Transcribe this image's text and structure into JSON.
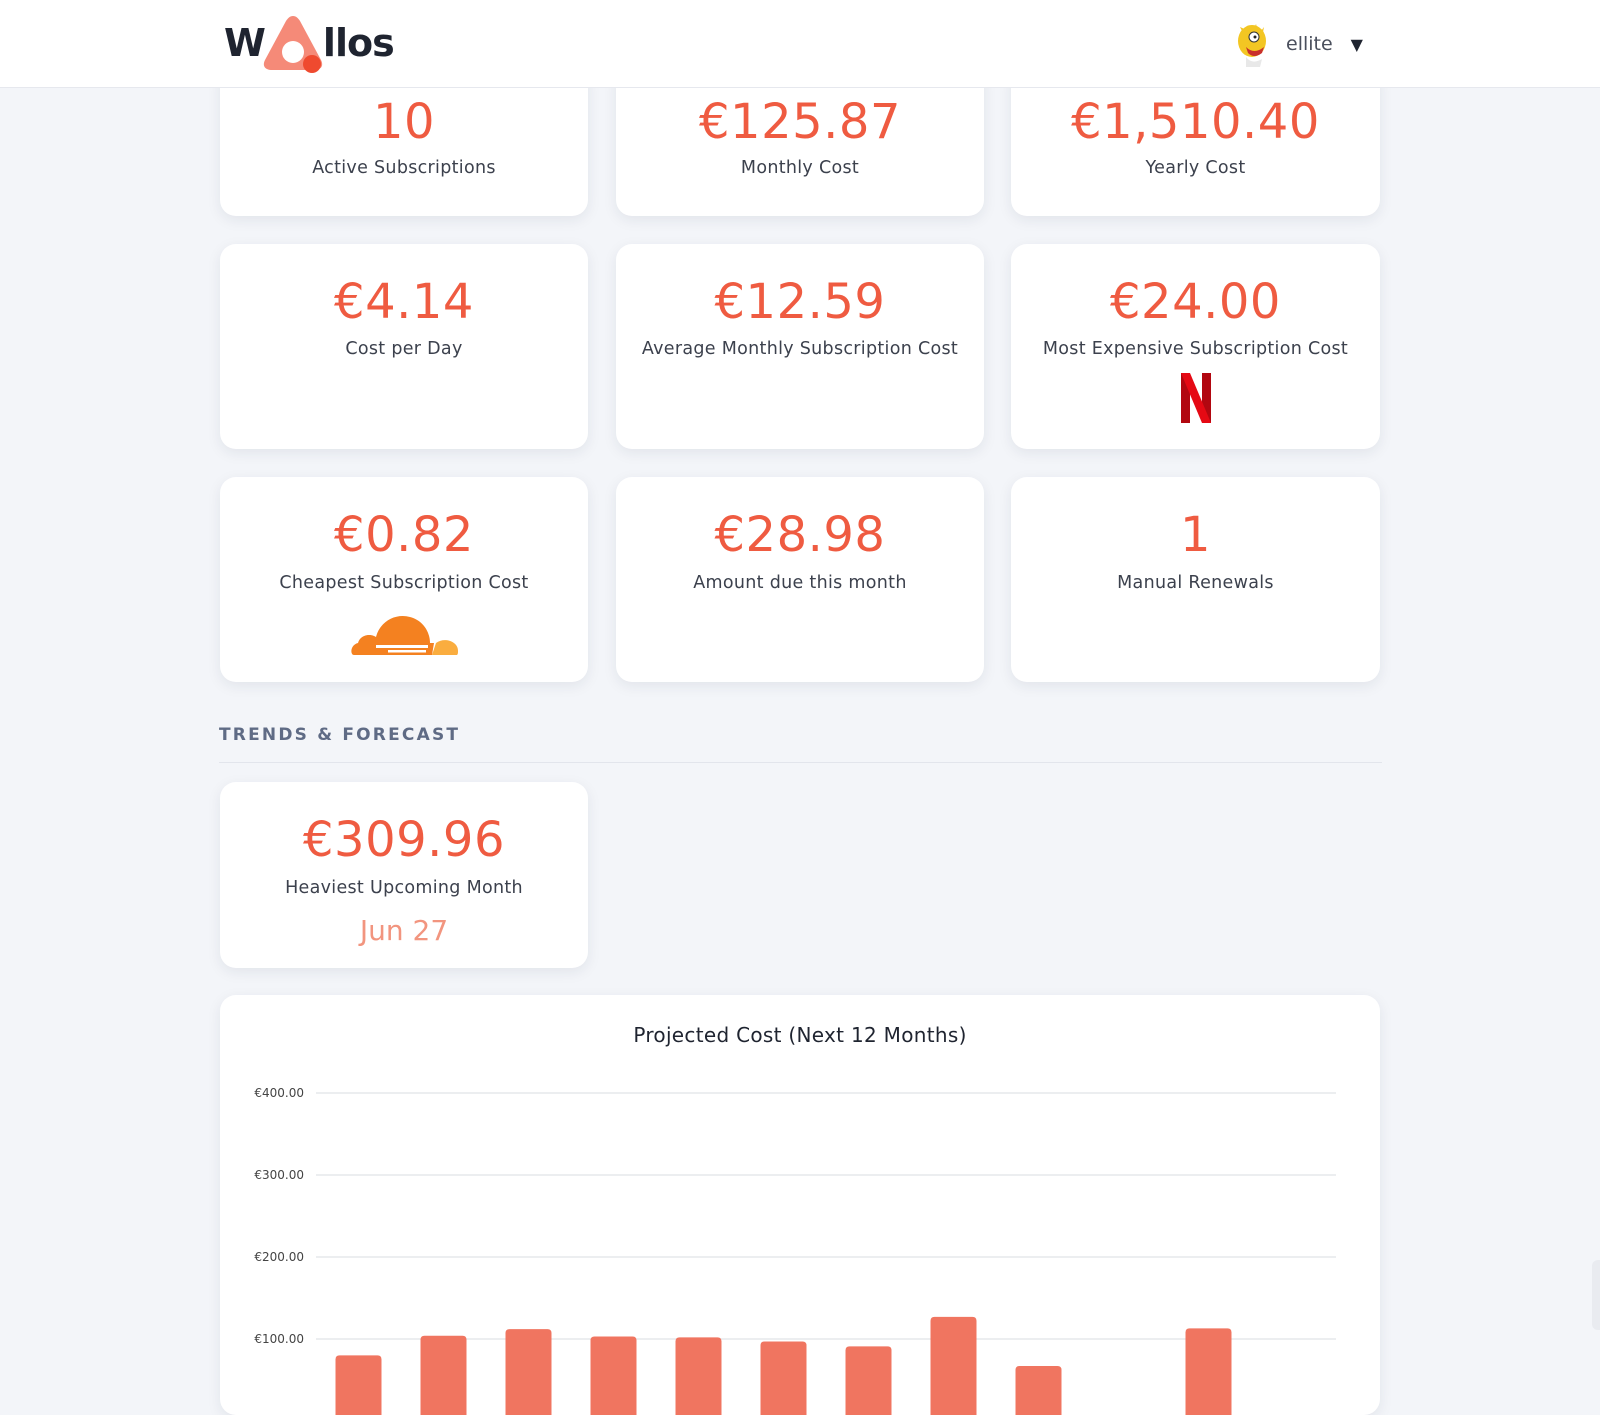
{
  "header": {
    "logo_left": "W",
    "logo_right": "llos",
    "username": "ellite",
    "caret": "▼",
    "logo_icon": "wallos-triangle-logo",
    "avatar_icon": "cartoon-avatar-icon"
  },
  "stats": [
    {
      "value": "10",
      "label": "Active Subscriptions"
    },
    {
      "value": "€125.87",
      "label": "Monthly Cost"
    },
    {
      "value": "€1,510.40",
      "label": "Yearly Cost"
    },
    {
      "value": "€4.14",
      "label": "Cost per Day"
    },
    {
      "value": "€12.59",
      "label": "Average Monthly Subscription Cost"
    },
    {
      "value": "€24.00",
      "label": "Most Expensive Subscription Cost",
      "brand": "netflix-logo"
    },
    {
      "value": "€0.82",
      "label": "Cheapest Subscription Cost",
      "brand": "cloudflare-logo"
    },
    {
      "value": "€28.98",
      "label": "Amount due this month"
    },
    {
      "value": "1",
      "label": "Manual Renewals"
    }
  ],
  "trends": {
    "section_title": "TRENDS & FORECAST",
    "heaviest": {
      "value": "€309.96",
      "label": "Heaviest Upcoming Month",
      "month": "Jun 27"
    }
  },
  "colors": {
    "accent": "#ef5b41",
    "accent_light": "#f2957f",
    "bar": "#f07560",
    "netflix": "#d9111b",
    "cloudflare": "#f48120"
  },
  "chart_data": {
    "type": "bar",
    "title": "Projected Cost (Next 12 Months)",
    "ylim": [
      0,
      400
    ],
    "yticks": [
      100,
      200,
      300,
      400
    ],
    "ytick_labels": [
      "€100.00",
      "€200.00",
      "€300.00",
      "€400.00"
    ],
    "grid": true,
    "values": [
      80,
      104,
      112,
      103,
      102,
      97,
      91,
      127,
      67,
      null,
      113,
      null
    ]
  }
}
